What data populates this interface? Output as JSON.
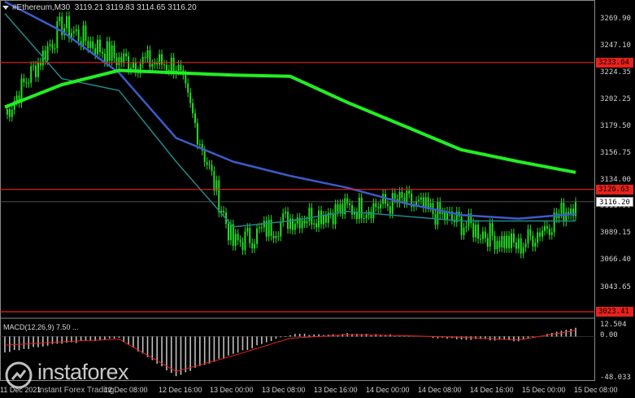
{
  "header": {
    "symbol_timeframe": "#Ethereum,M30",
    "ohlc": "3119.21 3119.83 3114.65 3116.20"
  },
  "macd": {
    "label": "MACD(12,26,9) 7.50 ...",
    "scale": [
      "12.504",
      "0.00",
      "-48.033"
    ]
  },
  "price_scale": [
    "3269.90",
    "3247.10",
    "3224.35",
    "3202.25",
    "3179.50",
    "3156.75",
    "3134.00",
    "3111.90",
    "3089.15",
    "3066.40",
    "3043.65"
  ],
  "levels": {
    "upper": "3233.64",
    "middle": "3126.63",
    "lower": "3023.41",
    "current": "3116.20"
  },
  "time_axis": [
    "11 Dec 2021",
    "12 Dec 08:00",
    "12 Dec 16:00",
    "13 Dec 00:00",
    "13 Dec 08:00",
    "13 Dec 16:00",
    "14 Dec 00:00",
    "14 Dec 08:00",
    "14 Dec 16:00",
    "15 Dec 00:00",
    "15 Dec 08:00"
  ],
  "branding": {
    "name": "instaforex",
    "tagline": "Instant Forex Trading"
  },
  "colors": {
    "background": "#000000",
    "candle": "#22dd22",
    "ma_fast": "#1f8a8a",
    "ma_mid": "#3b5cc9",
    "ma_slow": "#22ee22",
    "level_line": "#e8211b",
    "macd_histogram": "#bfbfbf",
    "macd_signal": "#e8211b"
  },
  "chart_data": {
    "type": "line",
    "symbol": "#Ethereum",
    "timeframe": "M30",
    "ylim": [
      3020,
      3285
    ],
    "x": [
      "11 Dec 2021",
      "12 Dec 08:00",
      "12 Dec 16:00",
      "13 Dec 00:00",
      "13 Dec 08:00",
      "13 Dec 16:00",
      "14 Dec 00:00",
      "14 Dec 08:00",
      "14 Dec 16:00",
      "15 Dec 00:00",
      "15 Dec 08:00"
    ],
    "series": [
      {
        "name": "price",
        "values": [
          3190,
          3265,
          3236,
          3232,
          3080,
          3102,
          3110,
          3116,
          3098,
          3078,
          3116
        ]
      },
      {
        "name": "ma_fast",
        "values": [
          3275,
          3220,
          3210,
          3150,
          3095,
          3100,
          3108,
          3104,
          3100,
          3100,
          3100
        ]
      },
      {
        "name": "ma_mid",
        "values": [
          3285,
          3260,
          3225,
          3170,
          3150,
          3138,
          3128,
          3115,
          3105,
          3102,
          3106
        ]
      },
      {
        "name": "ma_slow",
        "values": [
          3196,
          3215,
          3227,
          3225,
          3223,
          3222,
          3200,
          3180,
          3160,
          3150,
          3141
        ]
      }
    ],
    "horizontal_levels": [
      3233.64,
      3126.63,
      3023.41
    ],
    "macd": {
      "histogram": [
        -18,
        -8,
        -2,
        -45,
        -20,
        2,
        3,
        1,
        -3,
        -5,
        10
      ],
      "signal": [
        -10,
        -6,
        -3,
        -40,
        -22,
        -2,
        2,
        1,
        -1,
        -4,
        7
      ],
      "ylim": [
        -48.033,
        12.504
      ]
    },
    "grid": false
  }
}
